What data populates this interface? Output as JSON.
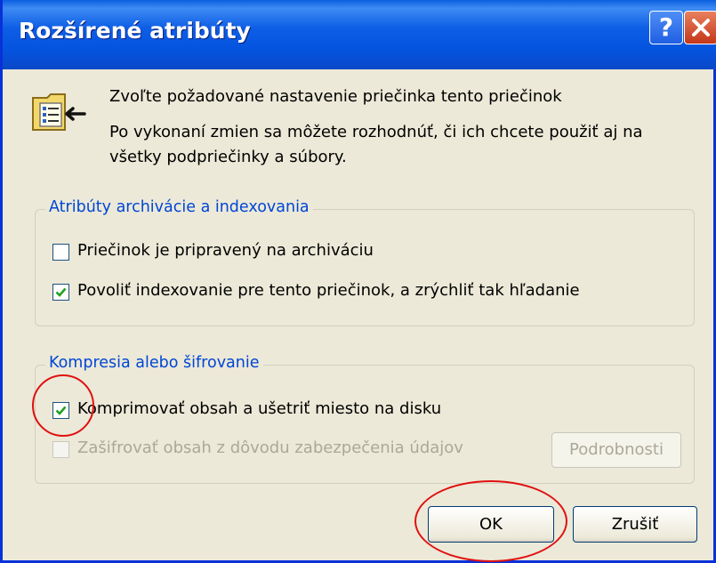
{
  "dialog": {
    "title": "Rozšírené atribúty",
    "help_glyph": "?",
    "intro_line1": "Zvoľte požadované nastavenie priečinka tento priečinok",
    "intro_line2": "Po vykonaní zmien sa môžete rozhodnúť, či ich chcete použiť aj na",
    "intro_line3": "všetky podpriečinky a súbory."
  },
  "archive_group": {
    "legend": "Atribúty archivácie a indexovania",
    "items": [
      {
        "label": "Priečinok je pripravený na archiváciu",
        "checked": false
      },
      {
        "label": "Povoliť indexovanie pre tento priečinok, a zrýchliť tak hľadanie",
        "checked": true
      }
    ]
  },
  "compress_group": {
    "legend": "Kompresia alebo šifrovanie",
    "items": [
      {
        "label": "Komprimovať obsah a ušetriť miesto na disku",
        "checked": true
      },
      {
        "label": "Zašifrovať obsah z dôvodu zabezpečenia údajov",
        "checked": false,
        "disabled": true
      }
    ],
    "details_label": "Podrobnosti"
  },
  "buttons": {
    "ok_label": "OK",
    "cancel_label": "Zrušiť"
  },
  "colors": {
    "titlebar": "#0554e0",
    "group_legend": "#0046d5",
    "annotation": "#e01010",
    "check": "#21a121"
  }
}
